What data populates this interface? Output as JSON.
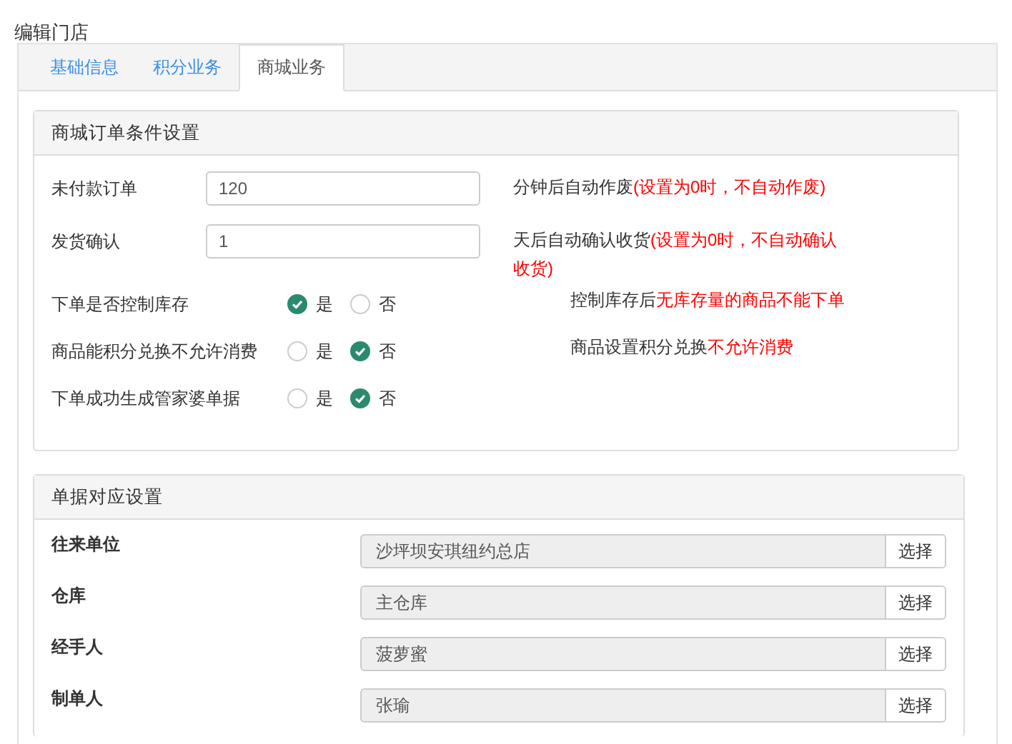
{
  "page_title": "编辑门店",
  "tabs": [
    {
      "label": "基础信息",
      "selected": false
    },
    {
      "label": "积分业务",
      "selected": false
    },
    {
      "label": "商城业务",
      "selected": true
    }
  ],
  "order_settings": {
    "title": "商城订单条件设置",
    "rows": [
      {
        "kind": "number",
        "label": "未付款订单",
        "value": "120",
        "note": "分钟后自动作废",
        "warning": "(设置为0时，不自动作废)"
      },
      {
        "kind": "number",
        "label": "发货确认",
        "value": "1",
        "note": "天后自动确认收货",
        "warning": "(设置为0时，不自动确认收货)"
      },
      {
        "kind": "choice",
        "label": "下单是否控制库存",
        "options": [
          {
            "label": "是",
            "selected": true
          },
          {
            "label": "否",
            "selected": false
          }
        ],
        "note": "控制库存后",
        "warning": "无库存量的商品不能下单"
      },
      {
        "kind": "choice",
        "label": "商品能积分兑换不允许消费",
        "options": [
          {
            "label": "是",
            "selected": false
          },
          {
            "label": "否",
            "selected": true
          }
        ],
        "note": "商品设置积分兑换",
        "warning": "不允许消费"
      },
      {
        "kind": "choice",
        "label": "下单成功生成管家婆单据",
        "options": [
          {
            "label": "是",
            "selected": false
          },
          {
            "label": "否",
            "selected": true
          }
        ]
      }
    ]
  },
  "document_settings": {
    "title": "单据对应设置",
    "rows": [
      {
        "label": "往来单位",
        "value": "沙坪坝安琪纽约总店",
        "button": "选择"
      },
      {
        "label": "仓库",
        "value": "主仓库",
        "button": "选择"
      },
      {
        "label": "经手人",
        "value": "菠萝蜜",
        "button": "选择"
      },
      {
        "label": "制单人",
        "value": "张瑜",
        "button": "选择"
      }
    ]
  }
}
